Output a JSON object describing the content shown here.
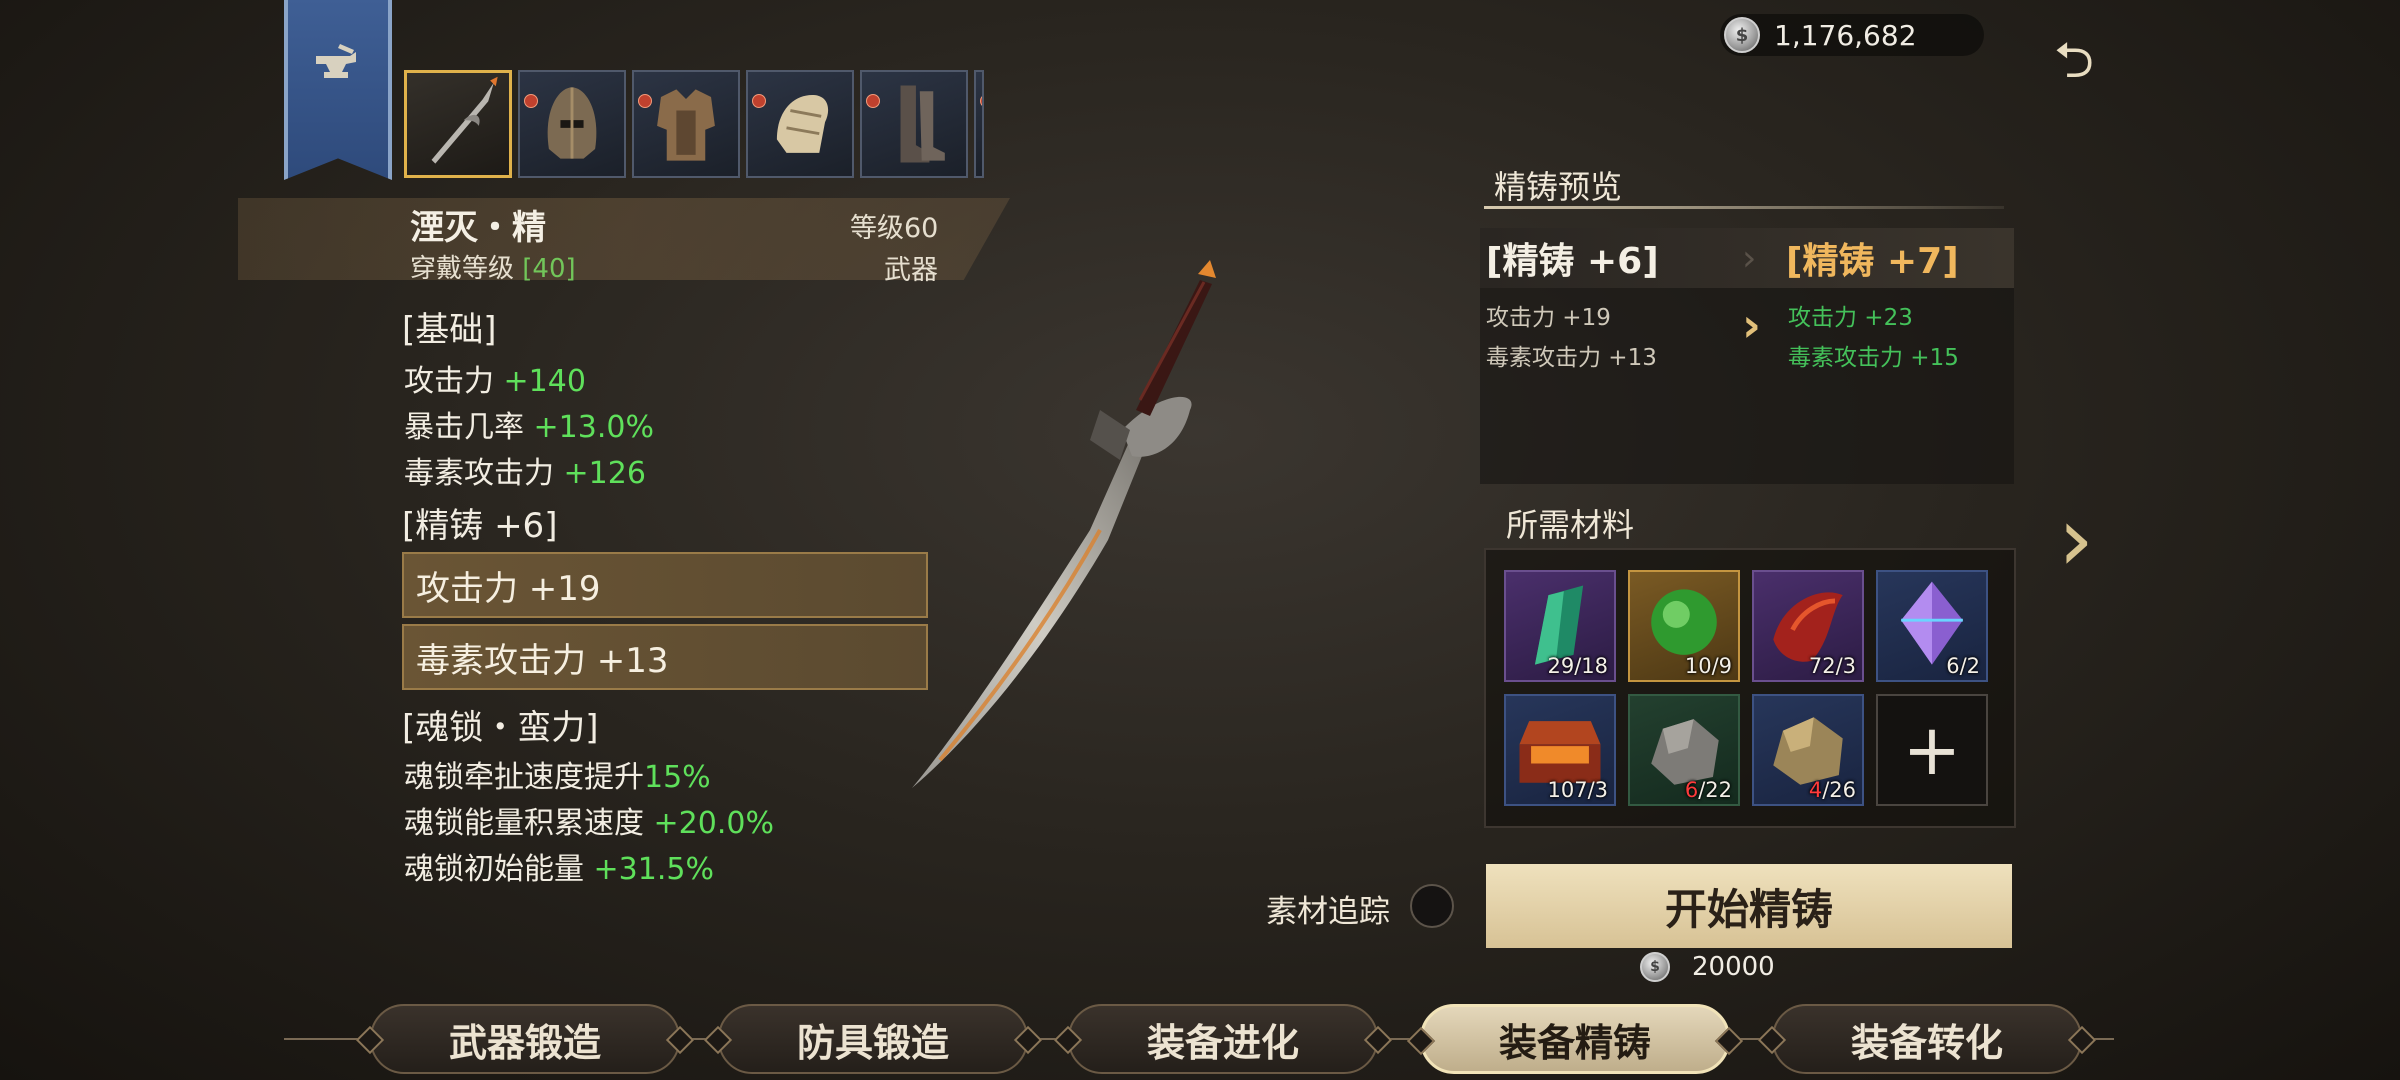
{
  "currency": {
    "amount": "1,176,682"
  },
  "item": {
    "name": "湮灭・精",
    "level": "等级60",
    "wear_label": "穿戴等级 ",
    "wear_level": "[40]",
    "type": "武器"
  },
  "stats": {
    "base_title": "[基础]",
    "base": [
      {
        "label": "攻击力 ",
        "value": "+140"
      },
      {
        "label": "暴击几率 ",
        "value": "+13.0%"
      },
      {
        "label": "毒素攻击力 ",
        "value": "+126"
      }
    ],
    "refine_title": "[精铸 +6]",
    "refine": [
      "攻击力 +19",
      "毒素攻击力 +13"
    ],
    "soul_title": "[魂锁・蛮力]",
    "soul": [
      {
        "label": "魂锁牵扯速度提升",
        "value": "15%"
      },
      {
        "label": "魂锁能量积累速度 ",
        "value": "+20.0%"
      },
      {
        "label": "魂锁初始能量 ",
        "value": "+31.5%"
      }
    ]
  },
  "preview": {
    "title": "精铸预览",
    "current_level": "[精铸 +6]",
    "next_level": "[精铸 +7]",
    "current_stats": [
      "攻击力 +19",
      "毒素攻击力 +13"
    ],
    "next_stats": [
      "攻击力 +23",
      "毒素攻击力 +15"
    ]
  },
  "materials": {
    "title": "所需材料",
    "items": [
      {
        "icon": "green-crystal-shard-icon",
        "have": "29",
        "need": "/18",
        "enough": true
      },
      {
        "icon": "green-orb-icon",
        "have": "10",
        "need": "/9",
        "enough": true
      },
      {
        "icon": "red-scale-icon",
        "have": "72",
        "need": "/3",
        "enough": true
      },
      {
        "icon": "purple-crystal-icon",
        "have": "6",
        "need": "/2",
        "enough": true
      },
      {
        "icon": "treasure-chest-icon",
        "have": "107",
        "need": "/3",
        "enough": true
      },
      {
        "icon": "grey-ore-icon",
        "have": "6",
        "need": "/22",
        "enough": false
      },
      {
        "icon": "gold-ore-icon",
        "have": "4",
        "need": "/26",
        "enough": false
      }
    ]
  },
  "actions": {
    "track_label": "素材追踪",
    "start_label": "开始精铸",
    "cost": "20000"
  },
  "tabs": [
    {
      "label": "武器锻造",
      "active": false
    },
    {
      "label": "防具锻造",
      "active": false
    },
    {
      "label": "装备进化",
      "active": false
    },
    {
      "label": "装备精铸",
      "active": true
    },
    {
      "label": "装备转化",
      "active": false
    }
  ],
  "colors": {
    "positive": "#5fe05b",
    "next_level": "#f0b75d",
    "insufficient": "#ff3b3b",
    "banner": "#3f5f95"
  }
}
